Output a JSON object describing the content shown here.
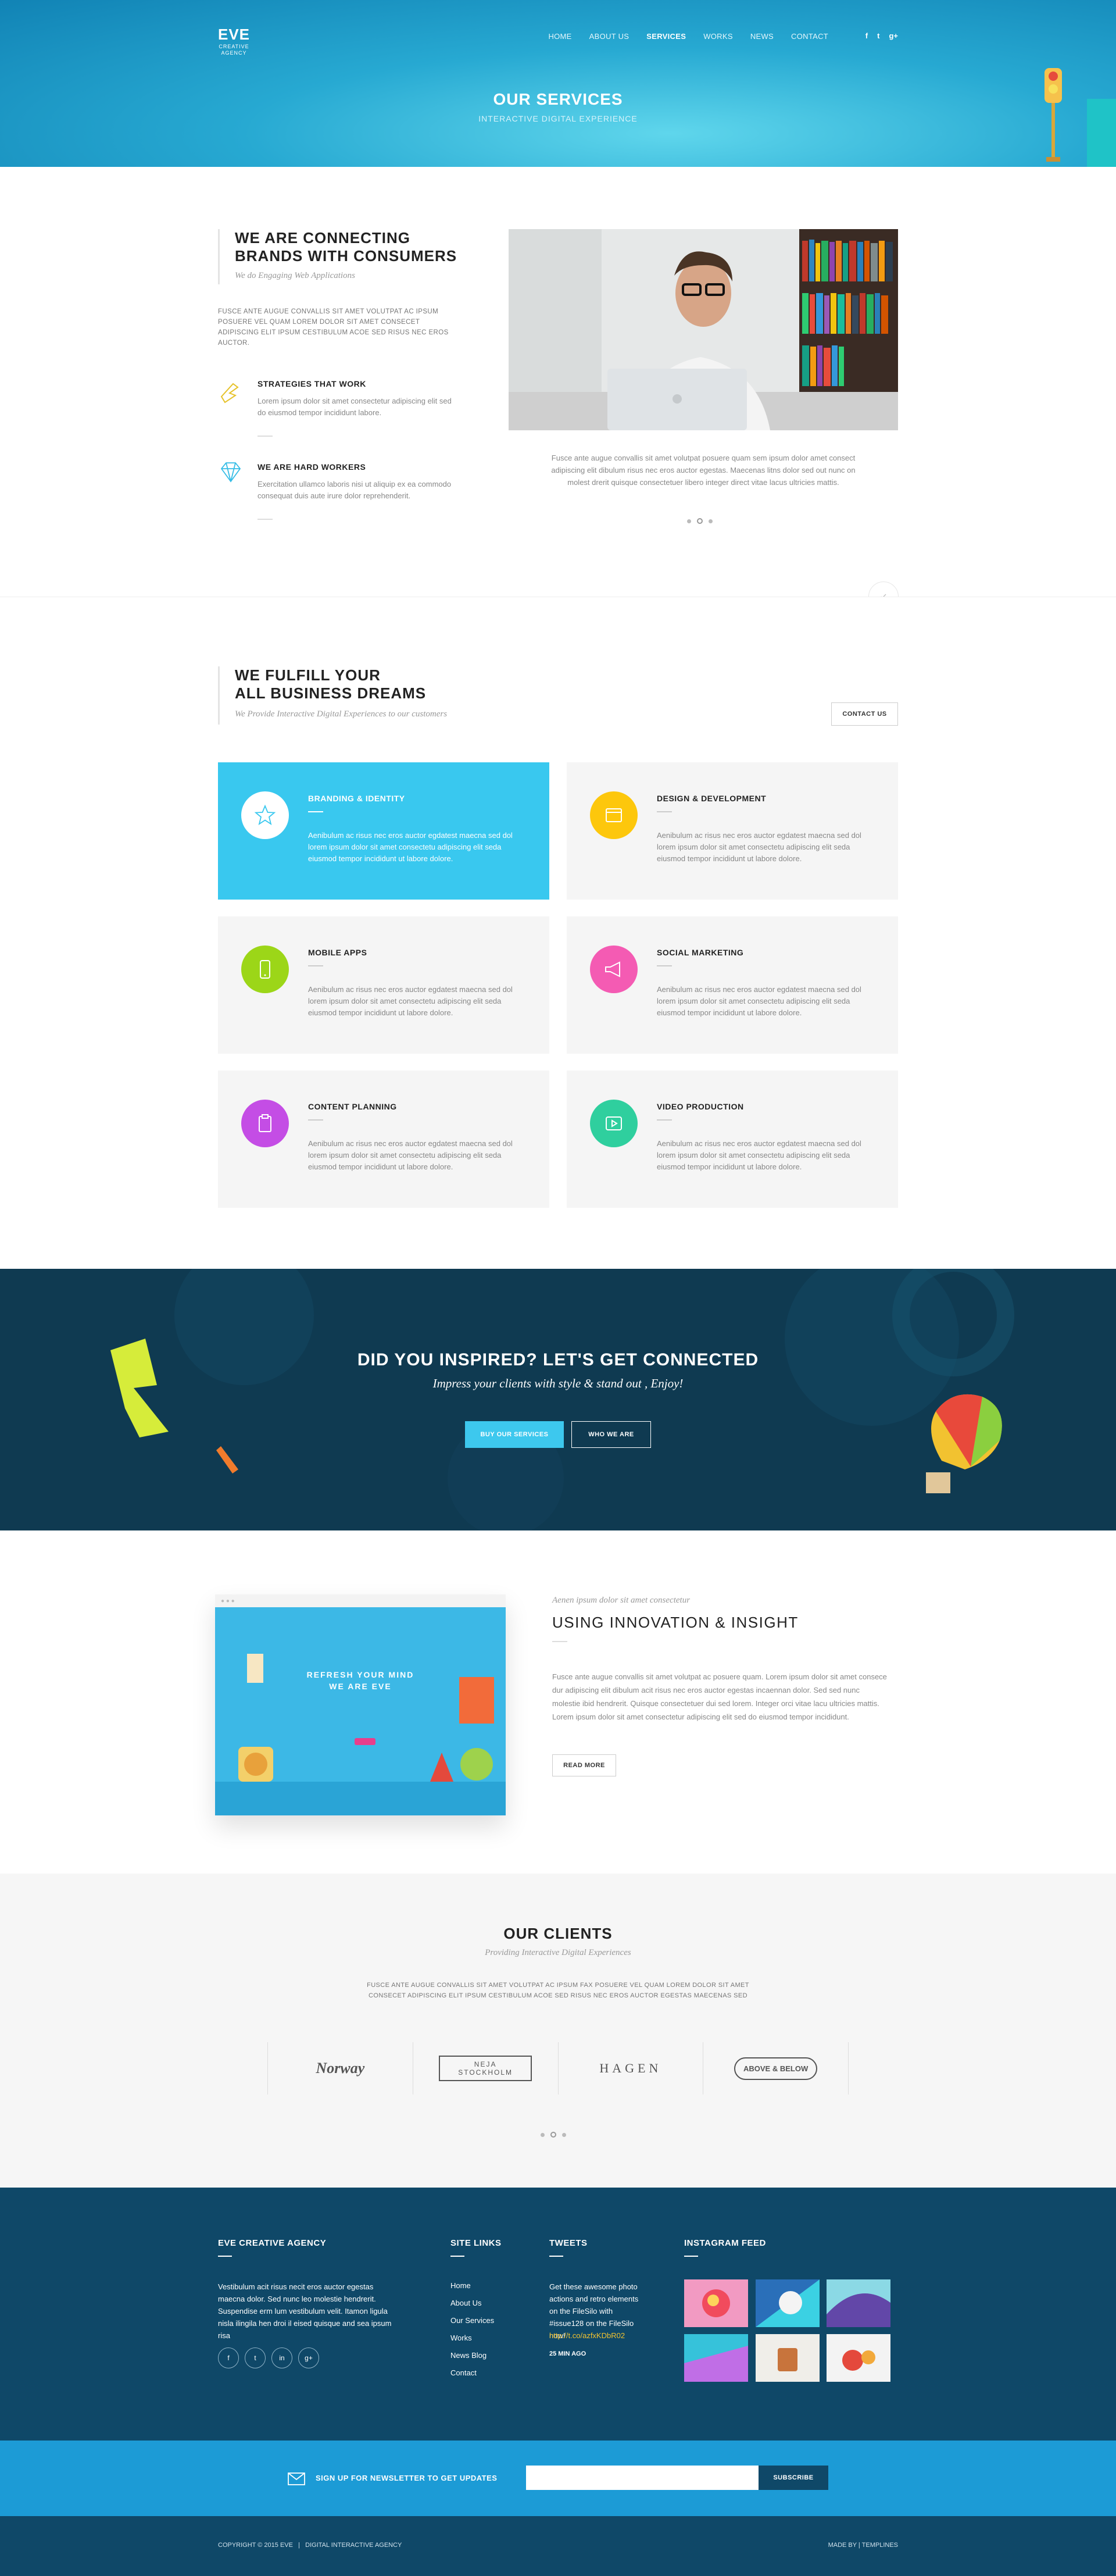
{
  "header": {
    "logo_mark": "EVE",
    "logo_sub1": "CREATIVE",
    "logo_sub2": "AGENCY",
    "nav": [
      "HOME",
      "ABOUT US",
      "SERVICES",
      "WORKS",
      "NEWS",
      "CONTACT"
    ],
    "active_nav": "SERVICES",
    "social": [
      "f",
      "t",
      "g+"
    ],
    "title": "OUR SERVICES",
    "subtitle": "INTERACTIVE DIGITAL EXPERIENCE"
  },
  "intro": {
    "heading_line1": "WE ARE CONNECTING",
    "heading_line2": "BRANDS WITH CONSUMERS",
    "tagline": "We do Engaging Web Applications",
    "paragraph": "FUSCE ANTE AUGUE CONVALLIS SIT AMET VOLUTPAT AC IPSUM POSUERE VEL QUAM LOREM DOLOR SIT AMET CONSECET ADIPISCING ELIT IPSUM CESTIBULUM ACOE SED RISUS NEC EROS AUCTOR.",
    "features": [
      {
        "title": "STRATEGIES THAT WORK",
        "text": "Lorem ipsum dolor sit amet consectetur adipiscing elit sed do eiusmod tempor incididunt labore."
      },
      {
        "title": "WE ARE HARD WORKERS",
        "text": "Exercitation ullamco laboris nisi ut aliquip ex ea commodo consequat duis aute irure dolor reprehenderit."
      }
    ],
    "caption": "Fusce ante augue convallis sit amet volutpat posuere quam sem ipsum dolor amet consect adipiscing elit dibulum risus nec eros auctor egestas. Maecenas litns dolor sed out nunc on molest drerit quisque consectetuer libero integer direct vitae lacus ultricies mattis."
  },
  "services": {
    "heading_line1": "WE FULFILL YOUR",
    "heading_line2": "ALL BUSINESS DREAMS",
    "tagline": "We Provide Interactive Digital Experiences to our customers",
    "contact_btn": "CONTACT US",
    "cards": [
      {
        "title": "BRANDING & IDENTITY",
        "text": "Aenibulum ac risus nec eros auctor egdatest maecna sed dol lorem ipsum dolor sit amet consectetu adipiscing elit seda eiusmod tempor incididunt ut labore dolore.",
        "color": "#ffffff",
        "icon": "star-icon"
      },
      {
        "title": "DESIGN & DEVELOPMENT",
        "text": "Aenibulum ac risus nec eros auctor egdatest maecna sed dol lorem ipsum dolor sit amet consectetu adipiscing elit seda eiusmod tempor incididunt ut labore dolore.",
        "color": "#fdc70c",
        "icon": "browser-icon"
      },
      {
        "title": "MOBILE APPS",
        "text": "Aenibulum ac risus nec eros auctor egdatest maecna sed dol lorem ipsum dolor sit amet consectetu adipiscing elit seda eiusmod tempor incididunt ut labore dolore.",
        "color": "#9cd618",
        "icon": "mobile-icon"
      },
      {
        "title": "SOCIAL MARKETING",
        "text": "Aenibulum ac risus nec eros auctor egdatest maecna sed dol lorem ipsum dolor sit amet consectetu adipiscing elit seda eiusmod tempor incididunt ut labore dolore.",
        "color": "#f45bb3",
        "icon": "megaphone-icon"
      },
      {
        "title": "CONTENT PLANNING",
        "text": "Aenibulum ac risus nec eros auctor egdatest maecna sed dol lorem ipsum dolor sit amet consectetu adipiscing elit seda eiusmod tempor incididunt ut labore dolore.",
        "color": "#c44de5",
        "icon": "clipboard-icon"
      },
      {
        "title": "VIDEO PRODUCTION",
        "text": "Aenibulum ac risus nec eros auctor egdatest maecna sed dol lorem ipsum dolor sit amet consectetu adipiscing elit seda eiusmod tempor incididunt ut labore dolore.",
        "color": "#2fcf9e",
        "icon": "play-icon"
      }
    ]
  },
  "cta": {
    "heading": "DID YOU INSPIRED? LET'S GET CONNECTED",
    "sub": "Impress your clients with style & stand out , Enjoy!",
    "btn1": "BUY OUR SERVICES",
    "btn2": "WHO WE ARE"
  },
  "innovation": {
    "kicker": "Aenen ipsum dolor sit amet consectetur",
    "heading": "USING INNOVATION & INSIGHT",
    "text": "Fusce ante augue convallis sit amet volutpat ac posuere quam. Lorem ipsum dolor sit amet consece dur adipiscing elit dibulum acit risus nec eros auctor egestas incaennan dolor. Sed sed nunc molestie ibid hendrerit. Quisque consectetuer dui sed lorem. Integer orci vitae lacu ultricies mattis. Lorem ipsum dolor sit amet consectetur adipiscing elit sed do eiusmod tempor incididunt.",
    "btn": "READ MORE",
    "mock_title1": "REFRESH YOUR MIND",
    "mock_title2": "WE ARE EVE"
  },
  "clients": {
    "heading": "OUR CLIENTS",
    "tagline": "Providing Interactive Digital Experiences",
    "text": "FUSCE ANTE AUGUE CONVALLIS SIT AMET VOLUTPAT AC IPSUM FAX POSUERE VEL QUAM LOREM DOLOR SIT AMET CONSECET ADIPISCING ELIT IPSUM CESTIBULUM ACOE SED RISUS NEC EROS AUCTOR EGESTAS MAECENAS SED",
    "logos": [
      "Norway",
      "NEJA STOCKHOLM",
      "HAGEN",
      "ABOVE & BELOW"
    ]
  },
  "footer": {
    "about_title": "EVE CREATIVE AGENCY",
    "about_text": "Vestibulum acit risus necit eros auctor egestas maecna dolor. Sed nunc leo molestie hendrerit. Suspendise erm lum vestibulum velit. Itamon ligula nisla ilingila hen droi il eised quisque and sea ipsum risa",
    "social": [
      "f",
      "t",
      "in",
      "g+"
    ],
    "links_title": "SITE LINKS",
    "links": [
      "Home",
      "About Us",
      "Our Services",
      "Works",
      "News Blog",
      "Contact"
    ],
    "tweets_title": "TWEETS",
    "tweet": "Get these awesome photo actions and retro elements on the FileSilo with #issue128 on the FileSilo now!",
    "tweet_link": "http://t.co/azfxKDbR02",
    "tweet_time": "25 MIN AGO",
    "insta_title": "INSTAGRAM FEED"
  },
  "newsletter": {
    "label": "SIGN UP FOR NEWSLETTER TO GET UPDATES",
    "placeholder": "",
    "btn": "SUBSCRIBE"
  },
  "bottom": {
    "copyright": "COPYRIGHT © 2015 EVE   |   DIGITAL INTERACTIVE AGENCY",
    "madeby": "MADE BY | TEMPLINES"
  }
}
